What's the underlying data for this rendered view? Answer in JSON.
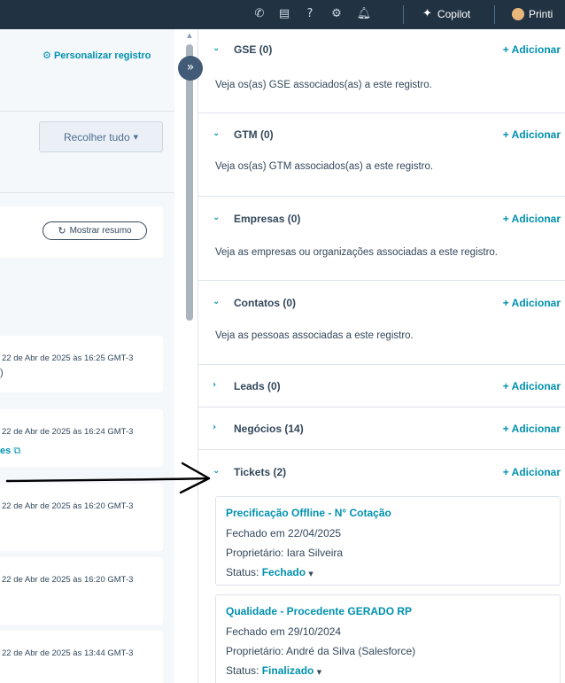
{
  "topbar": {
    "icons": [
      "phone-icon",
      "marketplace-icon",
      "help-icon",
      "settings-icon",
      "notifications-icon"
    ],
    "copilot_label": "Copilot",
    "user_label": "Printi"
  },
  "left": {
    "personalize_label": "Personalizar registro",
    "collapse_label": "Recolher tudo",
    "summary_label": "Mostrar resumo",
    "activities": [
      {
        "date": "22 de Abr de 2025 às 16:25 GMT-3",
        "extra": ")"
      },
      {
        "date": "22 de Abr de 2025 às 16:24 GMT-3",
        "extra": "es"
      },
      {
        "date": "22 de Abr de 2025 às 16:20 GMT-3",
        "extra": ""
      },
      {
        "date": "22 de Abr de 2025 às 16:20 GMT-3",
        "extra": ""
      },
      {
        "date": "22 de Abr de 2025 às 13:44 GMT-3",
        "extra": ""
      }
    ]
  },
  "right": {
    "add_label": "+ Adicionar",
    "sections": [
      {
        "title": "GSE (0)",
        "expanded": true,
        "description": "Veja os(as) GSE associados(as) a este registro."
      },
      {
        "title": "GTM (0)",
        "expanded": true,
        "description": "Veja os(as) GTM associados(as) a este registro."
      },
      {
        "title": "Empresas (0)",
        "expanded": true,
        "description": "Veja as empresas ou organizações associadas a este registro."
      },
      {
        "title": "Contatos (0)",
        "expanded": true,
        "description": "Veja as pessoas associadas a este registro."
      },
      {
        "title": "Leads (0)",
        "expanded": false,
        "description": ""
      },
      {
        "title": "Negócios (14)",
        "expanded": false,
        "description": ""
      },
      {
        "title": "Tickets (2)",
        "expanded": true,
        "description": ""
      }
    ],
    "tickets": [
      {
        "name": "Precificação Offline - N° Cotação",
        "closed": "Fechado em 22/04/2025",
        "owner_label": "Proprietário:",
        "owner": "Iara Silveira",
        "status_label": "Status:",
        "status": "Fechado"
      },
      {
        "name": "Qualidade - Procedente GERADO RP",
        "closed": "Fechado em 29/10/2024",
        "owner_label": "Proprietário:",
        "owner": "André da Silva (Salesforce)",
        "status_label": "Status:",
        "status": "Finalizado"
      }
    ]
  }
}
